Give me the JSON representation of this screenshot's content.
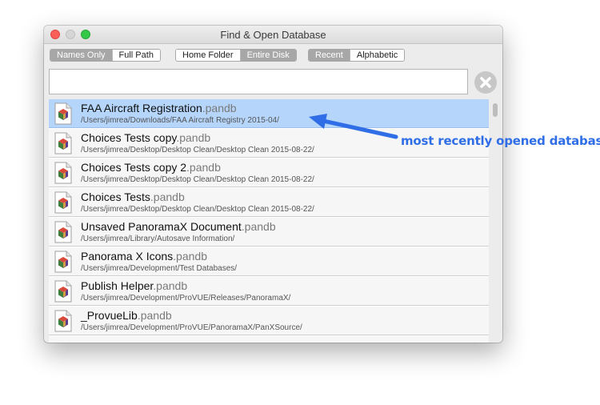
{
  "window": {
    "title": "Find & Open Database"
  },
  "controls": {
    "display_mode": {
      "options": [
        "Names Only",
        "Full Path"
      ],
      "selected": "Names Only"
    },
    "scope": {
      "options": [
        "Home Folder",
        "Entire Disk"
      ],
      "selected": "Entire Disk"
    },
    "sort": {
      "options": [
        "Recent",
        "Alphabetic"
      ],
      "selected": "Recent"
    }
  },
  "search": {
    "value": "",
    "placeholder": ""
  },
  "files": [
    {
      "name": "FAA Aircraft Registration",
      "ext": ".pandb",
      "path": "/Users/jimrea/Downloads/FAA Aircraft Registry 2015-04/",
      "selected": true
    },
    {
      "name": "Choices Tests copy",
      "ext": ".pandb",
      "path": "/Users/jimrea/Desktop/Desktop Clean/Desktop Clean 2015-08-22/",
      "selected": false
    },
    {
      "name": "Choices Tests copy 2",
      "ext": ".pandb",
      "path": "/Users/jimrea/Desktop/Desktop Clean/Desktop Clean 2015-08-22/",
      "selected": false
    },
    {
      "name": "Choices Tests",
      "ext": ".pandb",
      "path": "/Users/jimrea/Desktop/Desktop Clean/Desktop Clean 2015-08-22/",
      "selected": false
    },
    {
      "name": "Unsaved PanoramaX Document",
      "ext": ".pandb",
      "path": "/Users/jimrea/Library/Autosave Information/",
      "selected": false
    },
    {
      "name": "Panorama X Icons",
      "ext": ".pandb",
      "path": "/Users/jimrea/Development/Test Databases/",
      "selected": false
    },
    {
      "name": "Publish Helper",
      "ext": ".pandb",
      "path": "/Users/jimrea/Development/ProVUE/Releases/PanoramaX/",
      "selected": false
    },
    {
      "name": "_ProvueLib",
      "ext": ".pandb",
      "path": "/Users/jimrea/Development/ProVUE/PanoramaX/PanXSource/",
      "selected": false
    },
    {
      "name": "",
      "ext": "",
      "path": "",
      "selected": false
    }
  ],
  "annotation": {
    "text": "most recently opened database",
    "color": "#2f6ee6"
  },
  "colors": {
    "selection": "#b5d5fb",
    "segment_selected": "#a7a7a7",
    "close": "#fc5f57",
    "zoom": "#35c748"
  },
  "icons": {
    "file": "database-document-icon",
    "clear": "clear-x-circle-icon",
    "arrow": "pointer-arrow-icon"
  }
}
